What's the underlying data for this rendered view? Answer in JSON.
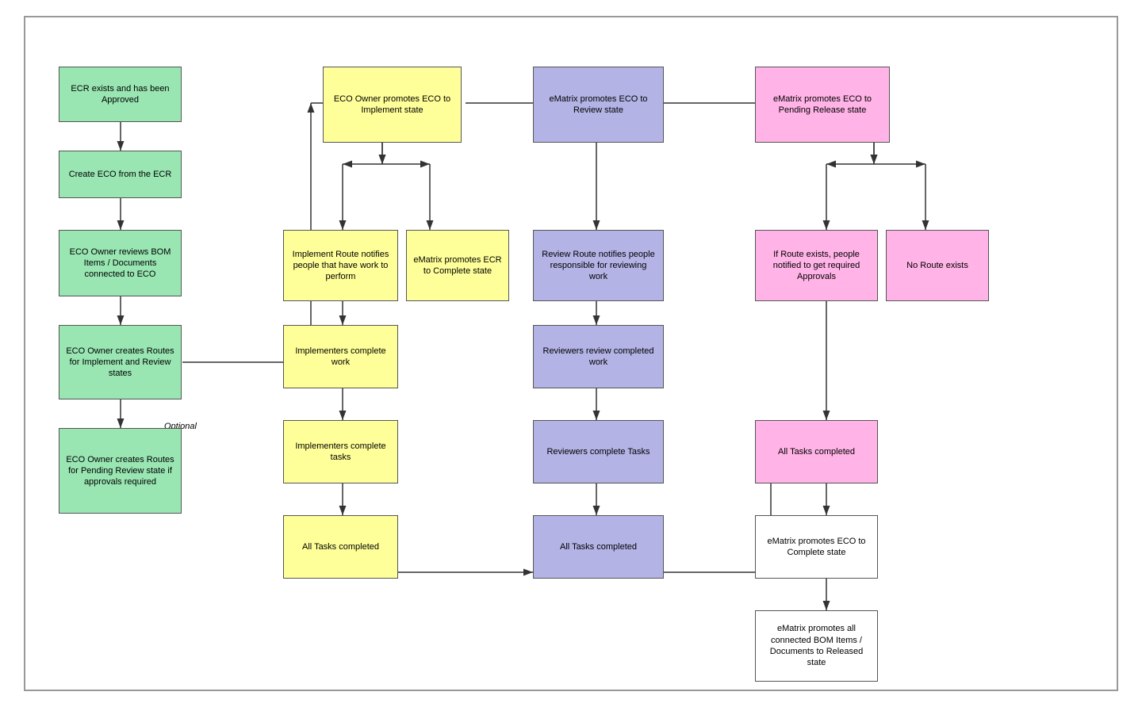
{
  "boxes": {
    "col1": {
      "b1": "ECR exists and has been Approved",
      "b2": "Create ECO from the ECR",
      "b3": "ECO Owner reviews BOM Items / Documents connected to ECO",
      "b4": "ECO Owner creates Routes for Implement and Review states",
      "b5": "ECO Owner creates Routes for Pending Review state if approvals required"
    },
    "col2": {
      "top": "ECO Owner promotes ECO to Implement state",
      "b1": "Implement Route notifies people that have work to perform",
      "b2": "eMatrix promotes ECR to Complete state",
      "b3": "Implementers complete work",
      "b4": "Implementers complete tasks",
      "b5": "All Tasks completed"
    },
    "col3": {
      "top": "eMatrix promotes ECO to Review state",
      "b1": "Review Route notifies people responsible for reviewing work",
      "b2": "Reviewers review completed work",
      "b3": "Reviewers complete Tasks",
      "b4": "All Tasks completed"
    },
    "col4": {
      "top": "eMatrix promotes ECO to Pending Release state",
      "b1": "If Route exists, people notified to get required Approvals",
      "b2": "No Route exists",
      "b3": "All Tasks completed",
      "b4": "eMatrix promotes ECO to Complete state",
      "b5": "eMatrix promotes all connected BOM Items / Documents to Released state"
    }
  },
  "label_optional": "Optional"
}
